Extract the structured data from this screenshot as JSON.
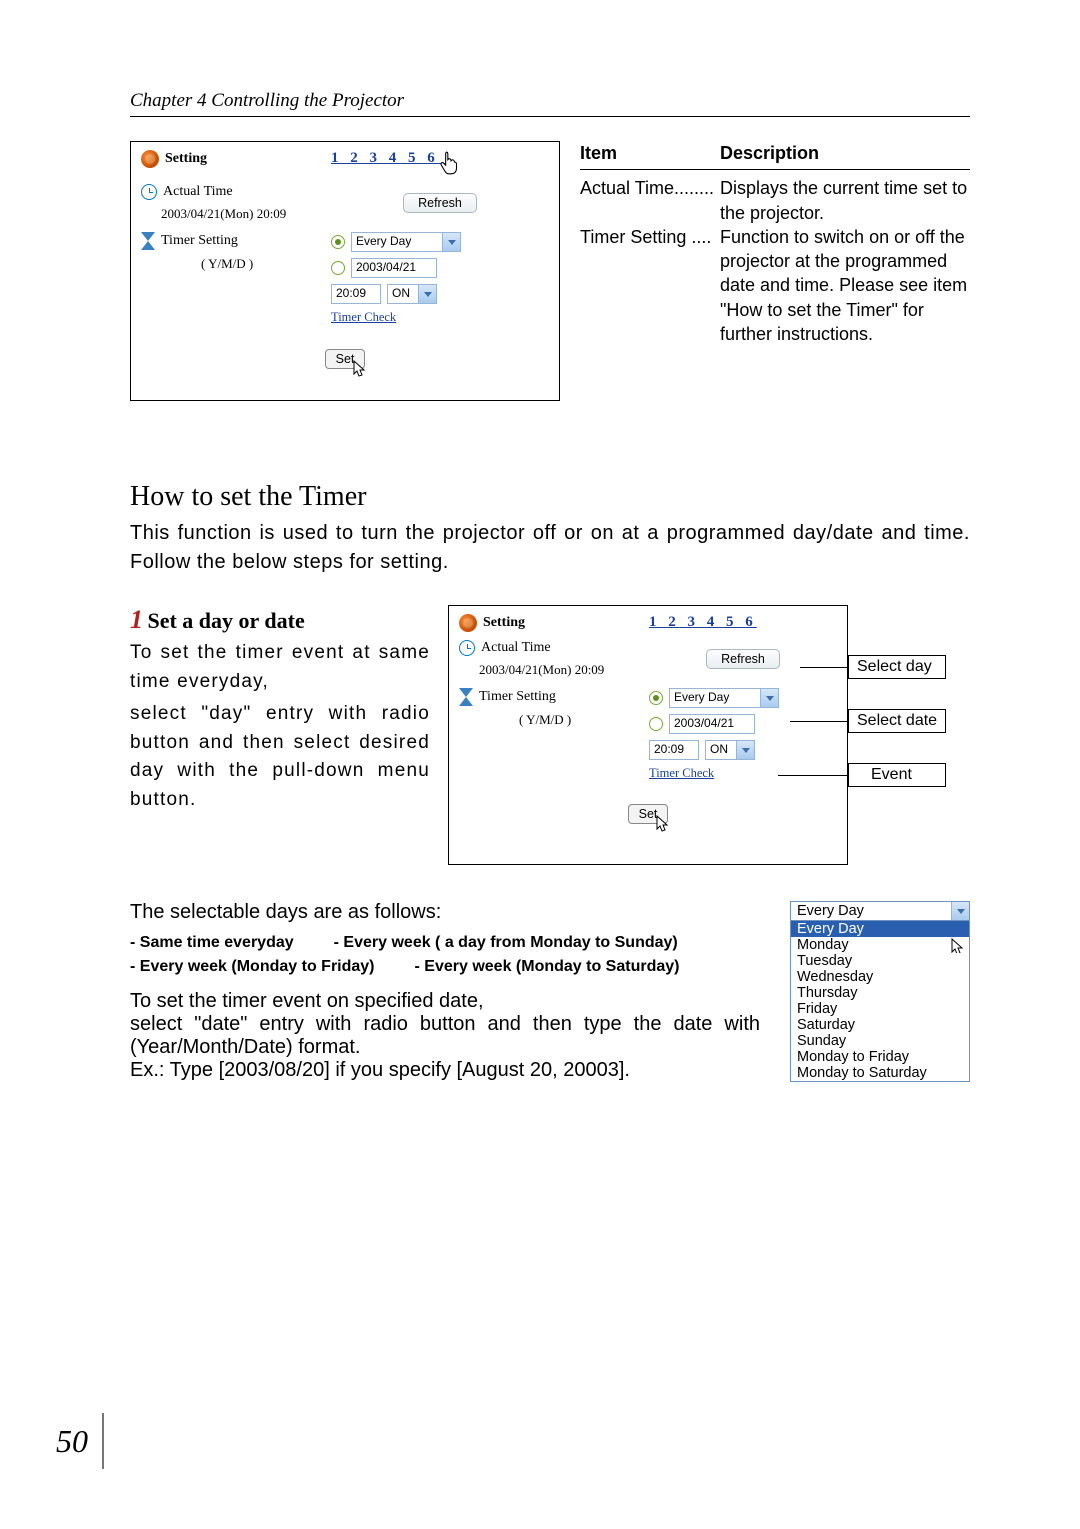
{
  "chapter_header": "Chapter 4 Controlling the Projector",
  "pagination": {
    "pages": [
      "1",
      "2",
      "3",
      "4",
      "5",
      "6"
    ],
    "current_index": 4
  },
  "panel": {
    "title": "Setting",
    "actual_time_label": "Actual Time",
    "actual_time_value": "2003/04/21(Mon) 20:09",
    "refresh": "Refresh",
    "timer_setting_label": "Timer Setting",
    "ymd_label": "( Y/M/D )",
    "day_option": "Every Day",
    "date_value": "2003/04/21",
    "time_value": "20:09",
    "on_off": "ON",
    "timer_check": "Timer Check",
    "set_btn": "Set"
  },
  "desc": {
    "head_item": "Item",
    "head_desc": "Description",
    "r1_item": "Actual Time",
    "r1_dots": "........",
    "r1_text": "Displays the current time set to the projector.",
    "r2_item": "Timer Setting",
    "r2_dots": "....",
    "r2_text": "Function to switch on or off the projector at the programmed date and time. Please see item \"How to set the Timer\" for further instructions."
  },
  "section_title": "How to set the Timer",
  "section_body": "This function is used to turn the projector off or on at a programmed day/date and time. Follow the below steps for setting.",
  "step1": {
    "num": "1",
    "title": "Set a day or date",
    "para1": "To set the timer event at same time everyday,",
    "para2": "select \"day\" entry with radio button and then select desired day with the pull-down menu button."
  },
  "callouts": {
    "select_day": "Select day",
    "select_date": "Select date",
    "event": "Event"
  },
  "selectable": {
    "intro": "The selectable days are as follows:",
    "b1": "- Same time everyday",
    "b2": "- Every week ( a day from Monday to Sunday)",
    "b3": "- Every week (Monday to Friday)",
    "b4": "- Every week (Monday to Saturday)",
    "p1": "To set the timer event on specified date,",
    "p2": "select \"date\" entry with radio button and then type the date with (Year/Month/Date) format.",
    "p3": "Ex.: Type [2003/08/20] if you specify [August 20, 20003]."
  },
  "dropdown": {
    "closed": "Every Day",
    "options": [
      "Every Day",
      "Monday",
      "Tuesday",
      "Wednesday",
      "Thursday",
      "Friday",
      "Saturday",
      "Sunday",
      "Monday to Friday",
      "Monday to Saturday"
    ],
    "selected_index": 0
  },
  "page_number": "50"
}
